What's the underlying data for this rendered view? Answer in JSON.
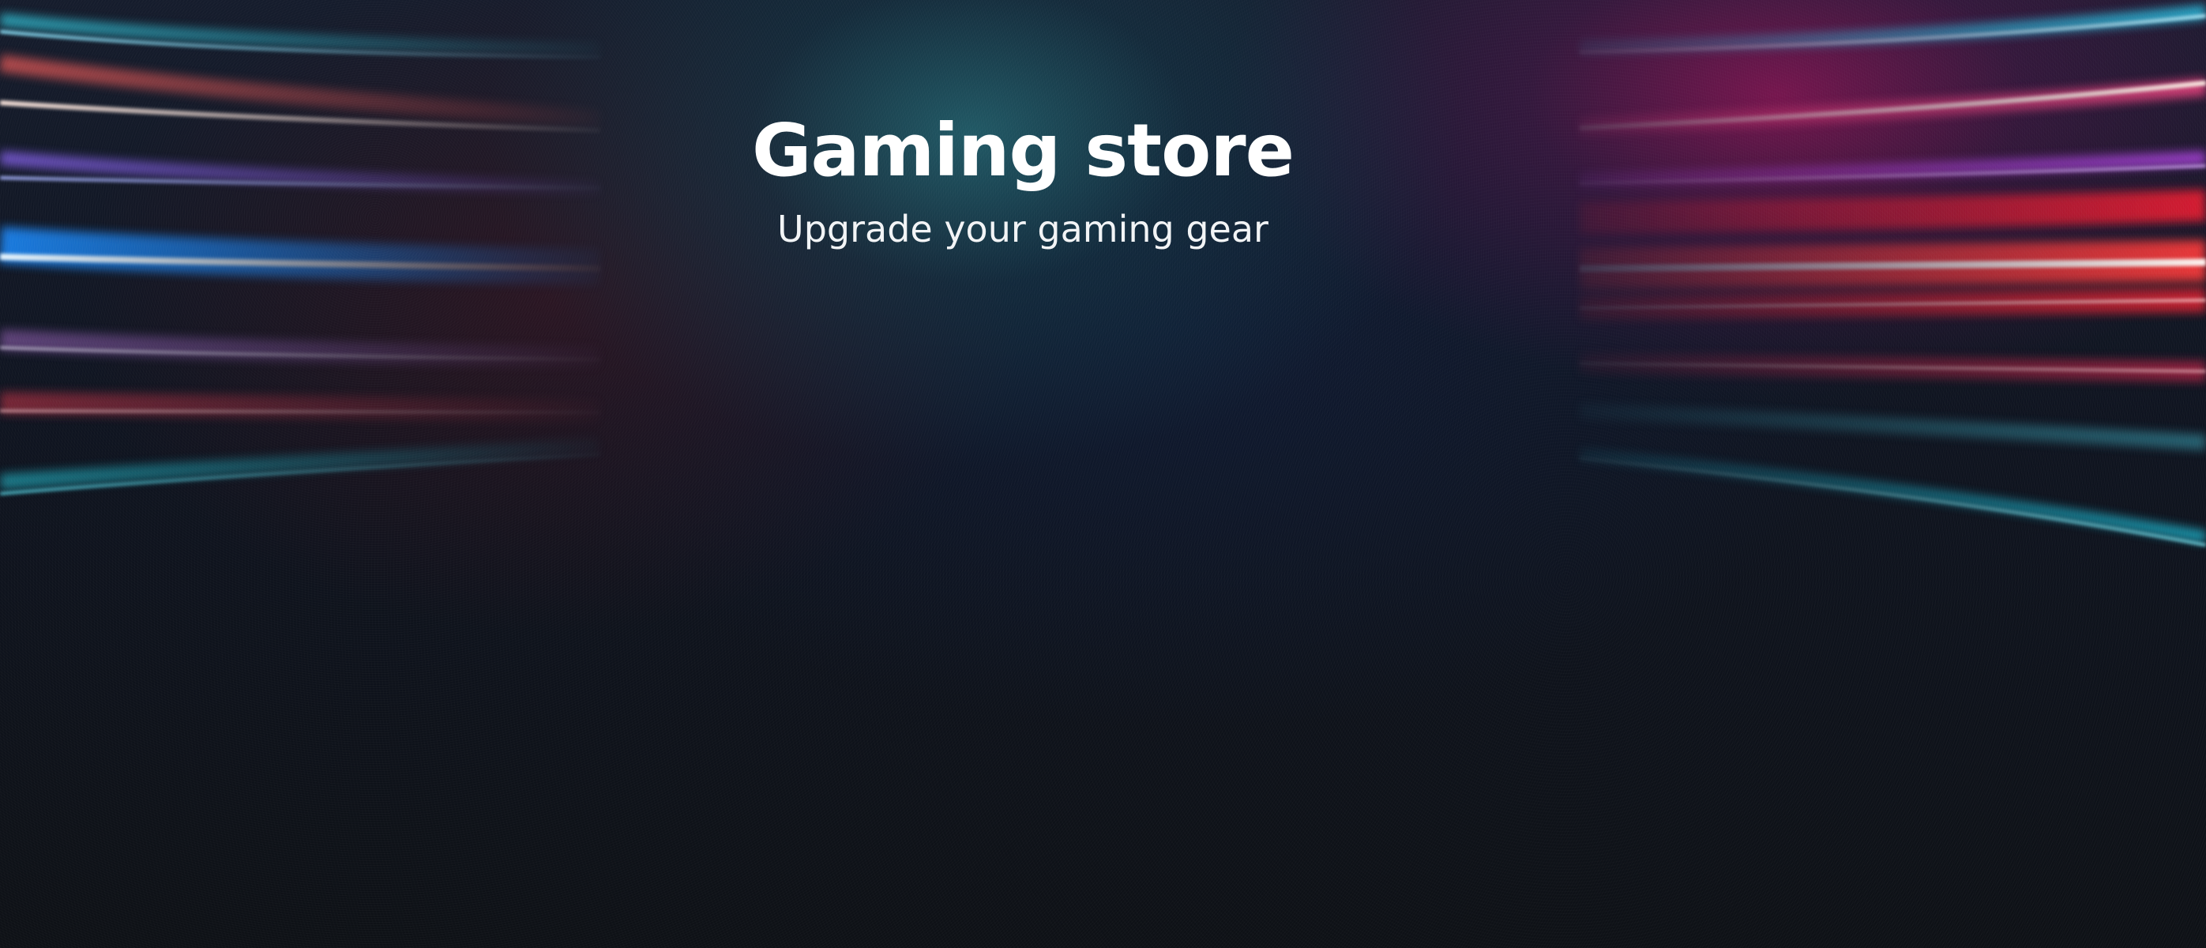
{
  "hero": {
    "title": "Gaming store",
    "subtitle": "Upgrade your gaming gear"
  },
  "colors": {
    "background": "#0e1218",
    "teal_glow": "#266e78",
    "magenta_glow": "#96145a",
    "left_streak_blue": "#3aa8ff",
    "right_streak_red": "#ff3344",
    "text": "#ffffff"
  }
}
